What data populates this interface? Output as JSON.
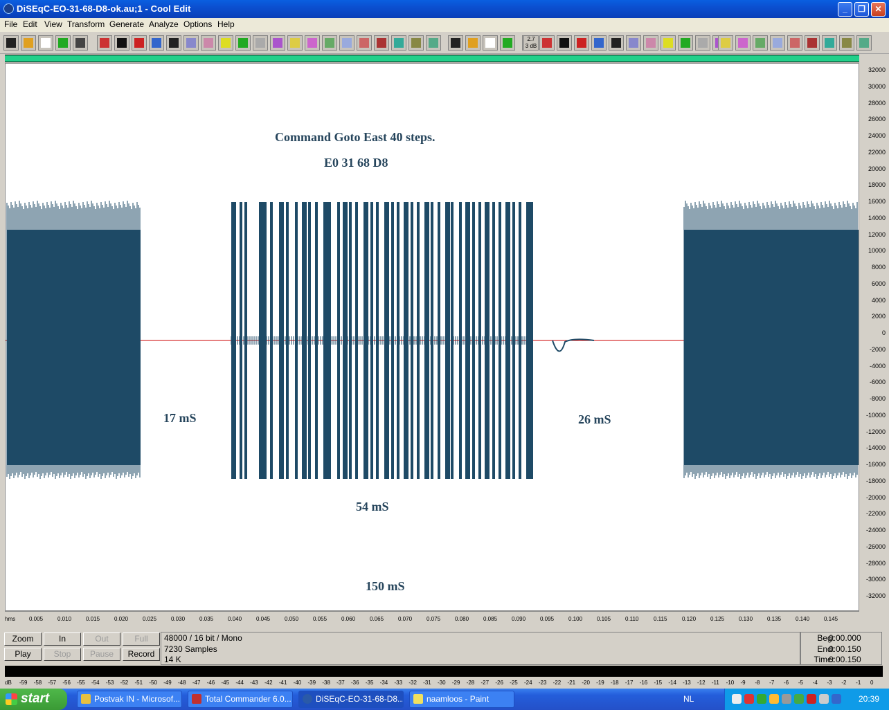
{
  "window": {
    "title": "DiSEqC-EO-31-68-D8-ok.au;1 - Cool Edit",
    "minimize": "_",
    "maximize": "❐",
    "close": "✕"
  },
  "menu": [
    "File",
    "Edit",
    "View",
    "Transform",
    "Generate",
    "Analyze",
    "Options",
    "Help"
  ],
  "toolbar": {
    "db_label_top": "2.7",
    "db_label_bottom": "3 dB"
  },
  "waveform": {
    "annotations": {
      "title": "Command Goto East 40 steps.",
      "hex": "E0 31 68 D8",
      "gap1": "17 mS",
      "burst": "54 mS",
      "gap2": "26 mS",
      "total": "150 mS"
    },
    "colors": {
      "wave": "#1e4a66",
      "baseline": "#cc0000",
      "background": "#ffffff"
    },
    "y_ticks": [
      "32000",
      "30000",
      "28000",
      "26000",
      "24000",
      "22000",
      "20000",
      "18000",
      "16000",
      "14000",
      "12000",
      "10000",
      "8000",
      "6000",
      "4000",
      "2000",
      "0",
      "-2000",
      "-4000",
      "-6000",
      "-8000",
      "-10000",
      "-12000",
      "-14000",
      "-16000",
      "-18000",
      "-20000",
      "-22000",
      "-24000",
      "-26000",
      "-28000",
      "-30000",
      "-32000"
    ],
    "x_ticks": [
      "hms",
      "0.005",
      "0.010",
      "0.015",
      "0.020",
      "0.025",
      "0.030",
      "0.035",
      "0.040",
      "0.045",
      "0.050",
      "0.055",
      "0.060",
      "0.065",
      "0.070",
      "0.075",
      "0.080",
      "0.085",
      "0.090",
      "0.095",
      "0.100",
      "0.105",
      "0.110",
      "0.115",
      "0.120",
      "0.125",
      "0.130",
      "0.135",
      "0.140",
      "0.145"
    ]
  },
  "controls": {
    "zoom": "Zoom",
    "in": "In",
    "out": "Out",
    "full": "Full",
    "play": "Play",
    "stop": "Stop",
    "pause": "Pause",
    "record": "Record"
  },
  "info": {
    "format": "48000 / 16 bit / Mono",
    "samples": "7230 Samples",
    "size": "14 K"
  },
  "time": {
    "beg_label": "Beg:",
    "beg_value": "0:00.000",
    "end_label": "End:",
    "end_value": "0:00.150",
    "time_label": "Time:",
    "time_value": "0:00.150"
  },
  "meter_scale": [
    "dB",
    "-59",
    "-58",
    "-57",
    "-56",
    "-55",
    "-54",
    "-53",
    "-52",
    "-51",
    "-50",
    "-49",
    "-48",
    "-47",
    "-46",
    "-45",
    "-44",
    "-43",
    "-42",
    "-41",
    "-40",
    "-39",
    "-38",
    "-37",
    "-36",
    "-35",
    "-34",
    "-33",
    "-32",
    "-31",
    "-30",
    "-29",
    "-28",
    "-27",
    "-26",
    "-25",
    "-24",
    "-23",
    "-22",
    "-21",
    "-20",
    "-19",
    "-18",
    "-17",
    "-16",
    "-15",
    "-14",
    "-13",
    "-12",
    "-11",
    "-10",
    "-9",
    "-8",
    "-7",
    "-6",
    "-5",
    "-4",
    "-3",
    "-2",
    "-1",
    "0"
  ],
  "taskbar": {
    "start": "start",
    "tasks": [
      "Postvak IN - Microsof...",
      "Total Commander 6.0...",
      "DiSEqC-EO-31-68-D8...",
      "naamloos - Paint"
    ],
    "language": "NL",
    "clock": "20:39"
  }
}
